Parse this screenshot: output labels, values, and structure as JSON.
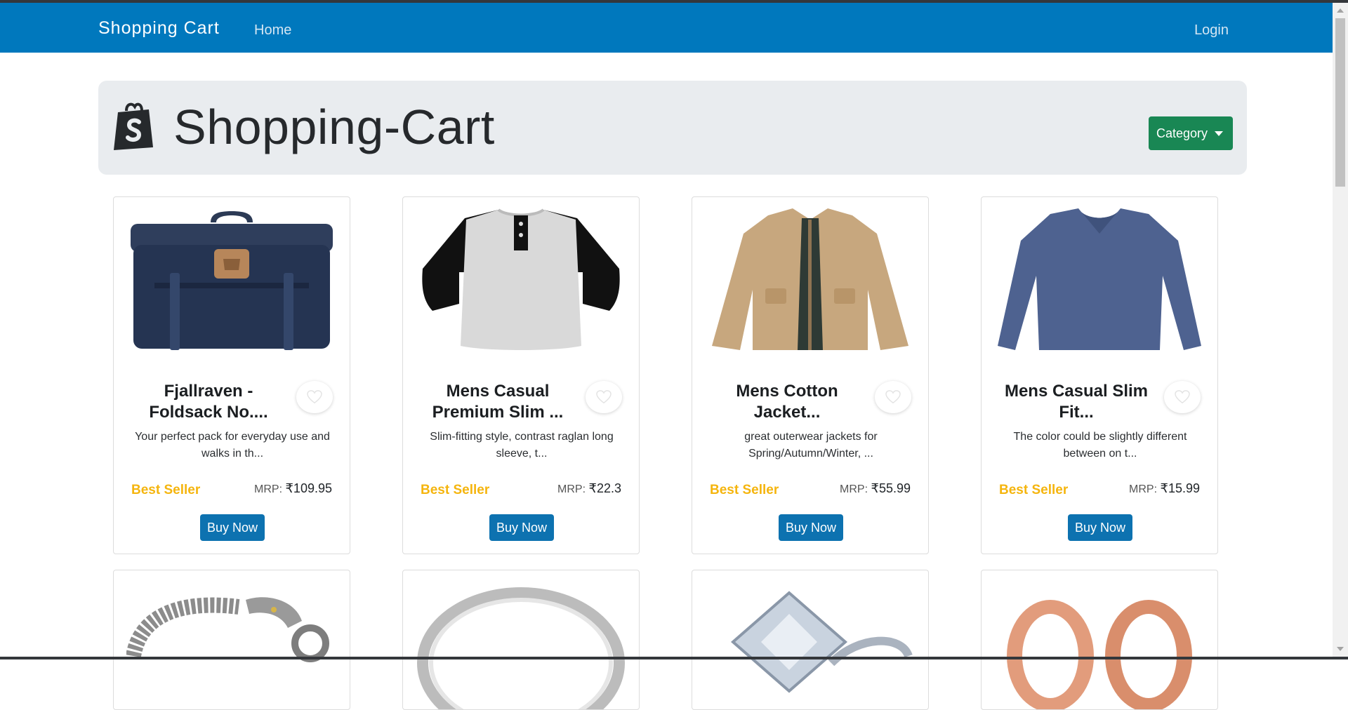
{
  "navbar": {
    "brand": "Shopping Cart",
    "home": "Home",
    "login": "Login"
  },
  "hero": {
    "title": "Shopping-Cart",
    "category_label": "Category"
  },
  "products": [
    {
      "name": "Fjallraven - Foldsack No....",
      "desc": "Your perfect pack for everyday use and walks in th...",
      "badge": "Best Seller",
      "mrp": "MRP: ",
      "price": "₹109.95",
      "buy": "Buy Now"
    },
    {
      "name": "Mens Casual Premium Slim ...",
      "desc": "Slim-fitting style, contrast raglan long sleeve, t...",
      "badge": "Best Seller",
      "mrp": "MRP: ",
      "price": "₹22.3",
      "buy": "Buy Now"
    },
    {
      "name": "Mens Cotton Jacket...",
      "desc": "great outerwear jackets for Spring/Autumn/Winter, ...",
      "badge": "Best Seller",
      "mrp": "MRP: ",
      "price": "₹55.99",
      "buy": "Buy Now"
    },
    {
      "name": "Mens Casual Slim Fit...",
      "desc": "The color could be slightly different between on t...",
      "badge": "Best Seller",
      "mrp": "MRP: ",
      "price": "₹15.99",
      "buy": "Buy Now"
    }
  ],
  "colors": {
    "navbar": "#0078bd",
    "button": "#0d72b0",
    "category": "#198754",
    "badge": "#f5b50e"
  }
}
